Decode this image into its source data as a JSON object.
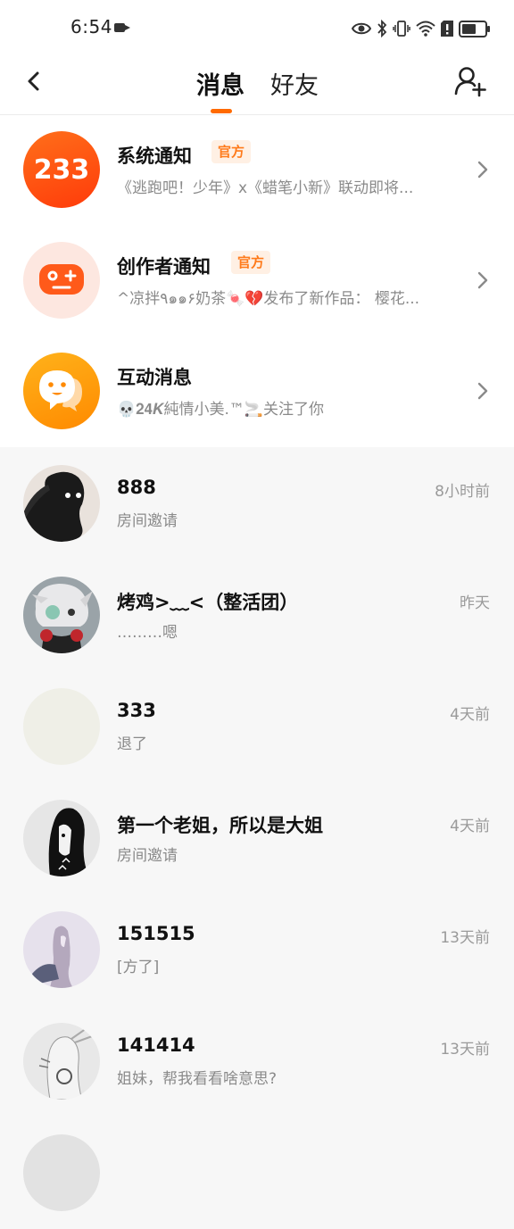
{
  "status_bar": {
    "time": "6:54",
    "icons": [
      "camera-icon",
      "eye-icon",
      "bluetooth-icon",
      "vibrate-icon",
      "wifi-icon",
      "sim-alert-icon",
      "battery-icon"
    ]
  },
  "header": {
    "tabs": [
      {
        "label": "消息",
        "active": true
      },
      {
        "label": "好友",
        "active": false
      }
    ],
    "accent_color": "#ff6a00"
  },
  "system_items": [
    {
      "title": "系统通知",
      "badge": "官方",
      "subtitle": "《逃跑吧！少年》x《蜡笔小新》联动即将...",
      "avatar_text": "233",
      "avatar_icon": "logo-233-icon"
    },
    {
      "title": "创作者通知",
      "badge": "官方",
      "subtitle": "^凉拌٩๑๑۶奶茶🍬💔发布了新作品：  樱花...",
      "avatar_icon": "gamepad-icon"
    },
    {
      "title": "互动消息",
      "badge": "",
      "subtitle": "💀𝟐𝟒𝑲純情小美.™🚬关注了你",
      "avatar_icon": "chat-bubble-icon"
    }
  ],
  "chats": [
    {
      "name": "888",
      "message": "房间邀请",
      "time": "8小时前"
    },
    {
      "name": "烤鸡>﹏<（整活团）",
      "message": "………嗯",
      "time": "昨天"
    },
    {
      "name": "333",
      "message": "退了",
      "time": "4天前"
    },
    {
      "name": "第一个老姐，所以是大姐",
      "message": "房间邀请",
      "time": "4天前"
    },
    {
      "name": "151515",
      "message": "[方了]",
      "time": "13天前"
    },
    {
      "name": "141414",
      "message": "姐妹，帮我看看啥意思?",
      "time": "13天前"
    }
  ]
}
